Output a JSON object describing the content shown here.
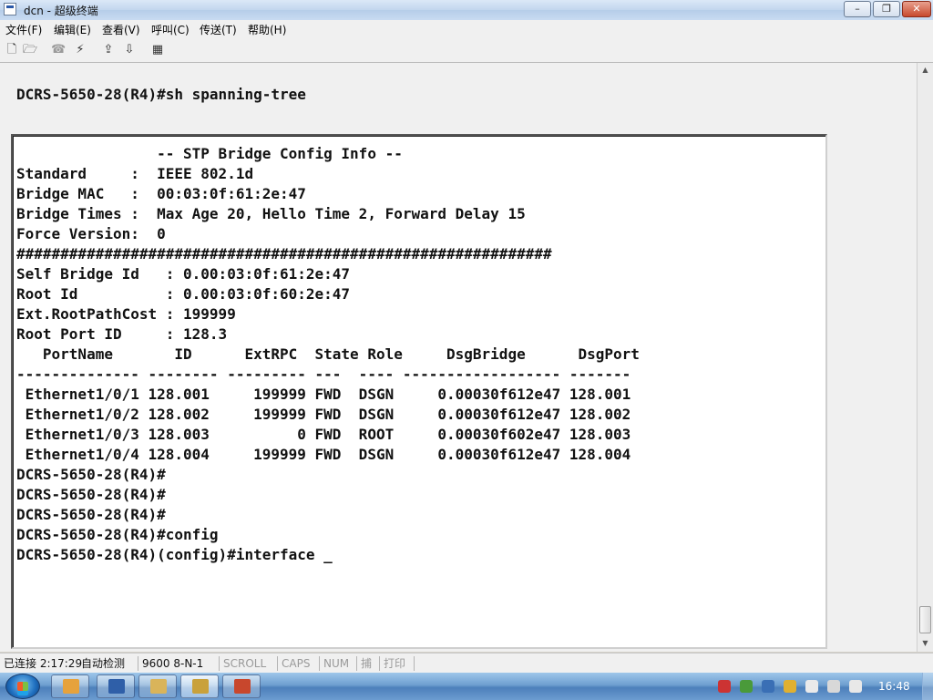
{
  "window": {
    "title": "dcn - 超级终端",
    "min": "–",
    "max": "❐",
    "close": "✕"
  },
  "menu": [
    "文件(F)",
    "编辑(E)",
    "查看(V)",
    "呼叫(C)",
    "传送(T)",
    "帮助(H)"
  ],
  "toolbar": {
    "icons": [
      "new-file-icon",
      "open-folder-icon",
      "phone-icon",
      "disconnect-icon",
      "send-icon",
      "receive-icon",
      "properties-icon"
    ]
  },
  "terminal": {
    "top_command": "DCRS-5650-28(R4)#sh spanning-tree",
    "lines": [
      "                -- STP Bridge Config Info --",
      "",
      "Standard     :  IEEE 802.1d",
      "Bridge MAC   :  00:03:0f:61:2e:47",
      "Bridge Times :  Max Age 20, Hello Time 2, Forward Delay 15",
      "Force Version:  0",
      "",
      "#############################################################",
      "Self Bridge Id   : 0.00:03:0f:61:2e:47",
      "Root Id          : 0.00:03:0f:60:2e:47",
      "Ext.RootPathCost : 199999",
      "Root Port ID     : 128.3",
      "",
      "   PortName       ID      ExtRPC  State Role     DsgBridge      DsgPort",
      "-------------- -------- --------- ---  ---- ------------------ -------",
      " Ethernet1/0/1 128.001     199999 FWD  DSGN     0.00030f612e47 128.001",
      " Ethernet1/0/2 128.002     199999 FWD  DSGN     0.00030f612e47 128.002",
      " Ethernet1/0/3 128.003          0 FWD  ROOT     0.00030f602e47 128.003",
      " Ethernet1/0/4 128.004     199999 FWD  DSGN     0.00030f612e47 128.004",
      "DCRS-5650-28(R4)#",
      "DCRS-5650-28(R4)#",
      "DCRS-5650-28(R4)#",
      "DCRS-5650-28(R4)#config",
      "DCRS-5650-28(R4)(config)#interface _"
    ]
  },
  "statusbar": {
    "connected": "已连接 2:17:29",
    "detect": "自动检测",
    "port": "9600 8-N-1",
    "scroll": "SCROLL",
    "caps": "CAPS",
    "num": "NUM",
    "capture": "捕",
    "print": "打印"
  },
  "taskbar": {
    "clock": "16:48",
    "colors": {
      "app1": "#e6a23c",
      "app2": "#2f5fa8",
      "app3": "#d9b45a",
      "app4": "#c9a13b",
      "app5": "#c8472d"
    }
  }
}
